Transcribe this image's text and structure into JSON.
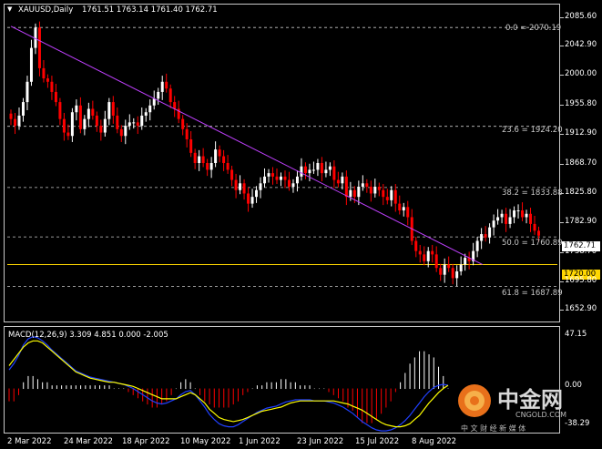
{
  "header": {
    "symbol": "XAUUSD,Daily",
    "ohlc": "1761.51 1763.14 1761.40 1762.71",
    "menu_icon": "triangle-down-icon"
  },
  "price_axis": {
    "labels": [
      "2085.60",
      "2042.90",
      "2000.00",
      "1955.80",
      "1912.90",
      "1868.70",
      "1825.80",
      "1782.90",
      "1738.70",
      "1695.80",
      "1652.90"
    ],
    "current_price": "1762.71",
    "support_price": "1720.00"
  },
  "fib_levels": [
    {
      "label": "0.0 = 2070.19",
      "price": 2070.19
    },
    {
      "label": "23.6 = 1924.20",
      "price": 1924.2
    },
    {
      "label": "38.2 = 1833.88",
      "price": 1833.88
    },
    {
      "label": "50.0 = 1760.89",
      "price": 1760.89
    },
    {
      "label": "61.8 = 1687.89",
      "price": 1687.89
    }
  ],
  "support_line": {
    "price": 1720.0
  },
  "macd": {
    "title": "MACD(12,26,9) 3.309 4.851 0.000 -2.005",
    "axis_labels": [
      "47.15",
      "0.00",
      "-38.29"
    ]
  },
  "date_axis": {
    "labels": [
      "2 Mar 2022",
      "24 Mar 2022",
      "18 Apr 2022",
      "10 May 2022",
      "1 Jun 2022",
      "23 Jun 2022",
      "15 Jul 2022",
      "8 Aug 2022"
    ]
  },
  "watermark": {
    "logo_icon": "cngold-logo-icon",
    "name": "中金网",
    "url": "CNGOLD.COM",
    "slogan": "中 文 财 经 新 媒 体"
  },
  "colors": {
    "bull": "#ffffff",
    "bear": "#ff0000",
    "trendline": "#c040ff",
    "support": "#ffd700",
    "macd_signal": "#ffff00",
    "macd_main": "#2040ff",
    "grid": "#c8c8c8"
  },
  "chart_data": {
    "type": "candlestick",
    "symbol": "XAUUSD",
    "timeframe": "Daily",
    "ylim": [
      1640,
      2100
    ],
    "trendline": {
      "from": [
        "2 Mar 2022",
        2072
      ],
      "to": [
        "23 Aug 2022",
        1720
      ]
    },
    "macd_ylim": [
      -40,
      48
    ],
    "closes": [
      1935,
      1925,
      1940,
      1960,
      1990,
      2040,
      2070,
      2010,
      1995,
      1990,
      1975,
      1960,
      1935,
      1915,
      1910,
      1945,
      1955,
      1920,
      1935,
      1950,
      1940,
      1925,
      1915,
      1935,
      1960,
      1940,
      1920,
      1910,
      1925,
      1930,
      1930,
      1925,
      1940,
      1945,
      1955,
      1965,
      1975,
      1990,
      1980,
      1960,
      1950,
      1935,
      1920,
      1905,
      1885,
      1870,
      1880,
      1870,
      1860,
      1870,
      1890,
      1880,
      1870,
      1860,
      1845,
      1830,
      1840,
      1825,
      1810,
      1820,
      1830,
      1840,
      1850,
      1855,
      1850,
      1845,
      1850,
      1845,
      1835,
      1840,
      1850,
      1865,
      1855,
      1860,
      1860,
      1870,
      1855,
      1860,
      1865,
      1845,
      1840,
      1850,
      1820,
      1830,
      1820,
      1835,
      1840,
      1835,
      1825,
      1835,
      1830,
      1820,
      1815,
      1830,
      1810,
      1800,
      1805,
      1790,
      1755,
      1740,
      1735,
      1725,
      1740,
      1735,
      1715,
      1705,
      1720,
      1715,
      1700,
      1710,
      1720,
      1730,
      1725,
      1740,
      1755,
      1765,
      1760,
      1775,
      1785,
      1790,
      1795,
      1780,
      1790,
      1800,
      1800,
      1790,
      1795,
      1780,
      1770,
      1762.71
    ],
    "macd_signal": [
      22,
      28,
      34,
      40,
      44,
      46,
      46,
      44,
      40,
      36,
      32,
      28,
      24,
      20,
      16,
      14,
      12,
      10,
      9,
      8,
      7,
      6,
      6,
      5,
      4,
      3,
      2,
      0,
      -2,
      -4,
      -6,
      -8,
      -10,
      -10,
      -10,
      -10,
      -8,
      -6,
      -4,
      -6,
      -10,
      -14,
      -20,
      -24,
      -28,
      -30,
      -31,
      -32,
      -31,
      -30,
      -28,
      -26,
      -24,
      -22,
      -21,
      -20,
      -19,
      -18,
      -16,
      -14,
      -13,
      -12,
      -12,
      -12,
      -12,
      -12,
      -12,
      -12,
      -12,
      -13,
      -14,
      -15,
      -17,
      -19,
      -21,
      -24,
      -27,
      -30,
      -33,
      -35,
      -36,
      -37,
      -37,
      -36,
      -34,
      -30,
      -26,
      -20,
      -14,
      -9,
      -4,
      0,
      3
    ],
    "macd_main": [
      18,
      24,
      32,
      42,
      48,
      50,
      49,
      46,
      42,
      37,
      33,
      29,
      25,
      21,
      17,
      15,
      13,
      11,
      10,
      9,
      8,
      7,
      6,
      5,
      4,
      2,
      0,
      -3,
      -6,
      -9,
      -12,
      -14,
      -15,
      -14,
      -12,
      -10,
      -6,
      -3,
      -2,
      -6,
      -12,
      -18,
      -25,
      -30,
      -34,
      -36,
      -37,
      -37,
      -35,
      -32,
      -29,
      -26,
      -23,
      -21,
      -19,
      -18,
      -17,
      -15,
      -13,
      -12,
      -11,
      -11,
      -11,
      -11,
      -12,
      -12,
      -12,
      -13,
      -14,
      -16,
      -18,
      -21,
      -24,
      -28,
      -32,
      -35,
      -38,
      -40,
      -41,
      -41,
      -40,
      -38,
      -35,
      -31,
      -26,
      -20,
      -14,
      -8,
      -3,
      1,
      3,
      4,
      3
    ]
  }
}
